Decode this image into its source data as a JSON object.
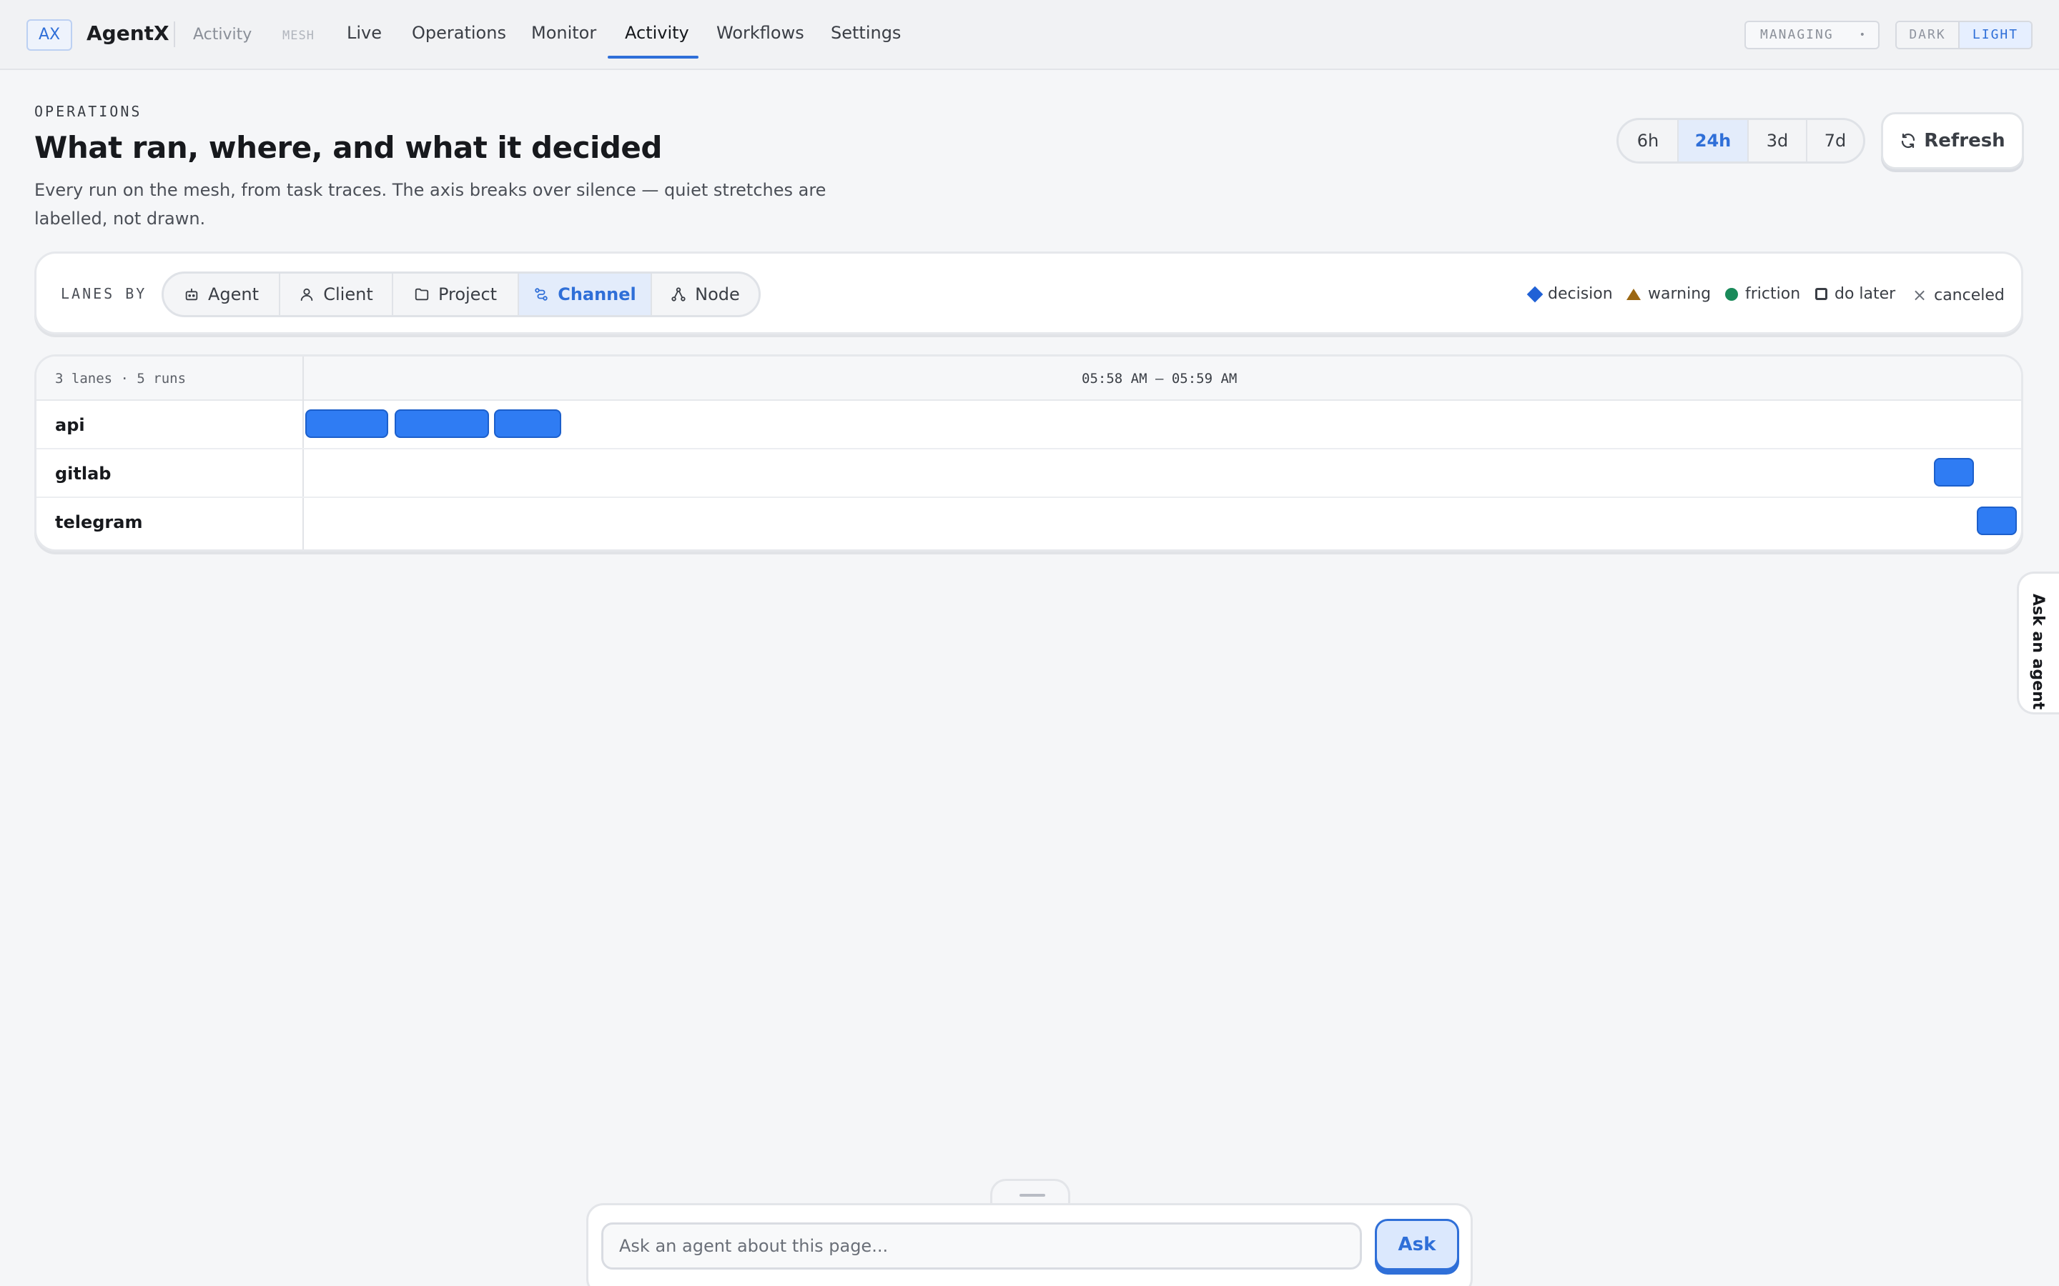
{
  "app": {
    "logo": "AX",
    "name": "AgentX",
    "crumb": "Activity",
    "mesh_tag": "MESH"
  },
  "nav": {
    "items": [
      {
        "label": "Live"
      },
      {
        "label": "Operations"
      },
      {
        "label": "Monitor"
      },
      {
        "label": "Activity",
        "active": true
      },
      {
        "label": "Workflows"
      },
      {
        "label": "Settings"
      }
    ]
  },
  "managing": {
    "label": "MANAGING",
    "indicator": "•"
  },
  "theme": {
    "dark": "DARK",
    "light": "LIGHT",
    "selected": "LIGHT"
  },
  "header": {
    "eyebrow": "OPERATIONS",
    "title": "What ran, where, and what it decided",
    "subtitle": "Every run on the mesh, from task traces. The axis breaks over silence — quiet stretches are labelled, not drawn."
  },
  "time_range": {
    "options": [
      "6h",
      "24h",
      "3d",
      "7d"
    ],
    "selected": "24h"
  },
  "refresh": {
    "label": "Refresh"
  },
  "lanes_by": {
    "label": "LANES BY",
    "options": [
      {
        "label": "Agent",
        "icon": "robot-icon"
      },
      {
        "label": "Client",
        "icon": "person-icon"
      },
      {
        "label": "Project",
        "icon": "folder-icon"
      },
      {
        "label": "Channel",
        "icon": "channel-icon",
        "active": true
      },
      {
        "label": "Node",
        "icon": "node-icon"
      }
    ]
  },
  "legend": [
    {
      "label": "decision",
      "marker": "diamond",
      "color": "#2061d6"
    },
    {
      "label": "warning",
      "marker": "triangle",
      "color": "#9b6712"
    },
    {
      "label": "friction",
      "marker": "dot",
      "color": "#1a8a5a"
    },
    {
      "label": "do later",
      "marker": "square",
      "color": "#3a3e45"
    },
    {
      "label": "canceled",
      "marker": "x",
      "color": "#6a6f78"
    }
  ],
  "timeline": {
    "summary": "3 lanes · 5 runs",
    "range_label": "05:58 AM – 05:59 AM",
    "run_color": "#2f7cf3",
    "lanes": [
      {
        "name": "api",
        "runs": [
          {
            "start": 0.0,
            "end": 0.05
          },
          {
            "start": 0.052,
            "end": 0.109
          },
          {
            "start": 0.11,
            "end": 0.151
          }
        ]
      },
      {
        "name": "gitlab",
        "runs": [
          {
            "start": 0.95,
            "end": 0.975
          }
        ]
      },
      {
        "name": "telegram",
        "runs": [
          {
            "start": 0.975,
            "end": 1.0
          }
        ]
      }
    ]
  },
  "side_tab": {
    "label": "Ask an agent"
  },
  "ask": {
    "placeholder": "Ask an agent about this page...",
    "button": "Ask"
  }
}
